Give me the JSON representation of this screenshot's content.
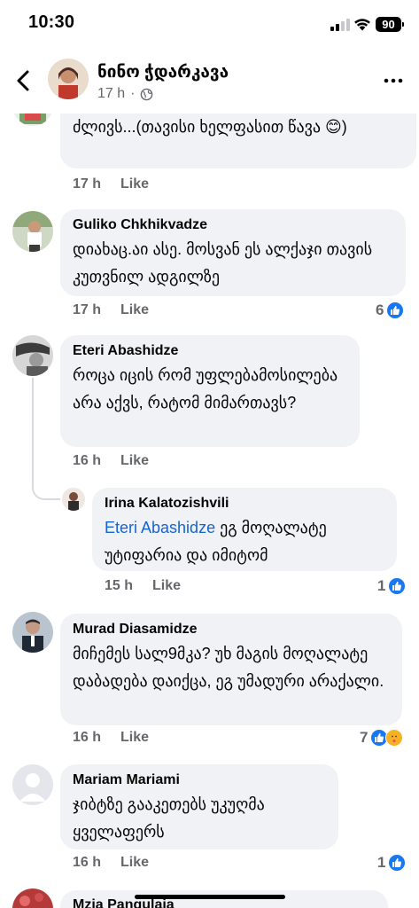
{
  "status_bar": {
    "time": "10:30",
    "battery": "90"
  },
  "header": {
    "name": "ნინო ჭდარკავა",
    "time": "17 h"
  },
  "comments": [
    {
      "author": "",
      "text": "ძლივს...(თავისი ხელფასით წავა 😊)",
      "time": "17 h",
      "like_label": "Like",
      "reaction_count": ""
    },
    {
      "author": "Guliko Chkhikvadze",
      "text": "დიახაც.აი ასე. მოსვან ეს ალქაჯი თავის კუთვნილ ადგილზე",
      "time": "17 h",
      "like_label": "Like",
      "reaction_count": "6"
    },
    {
      "author": "Eteri Abashidze",
      "text": "როცა იცის რომ უფლებამოსილება არა აქვს, რატომ მიმართავს?",
      "time": "16 h",
      "like_label": "Like",
      "reaction_count": ""
    },
    {
      "author": "Irina Kalatozishvili",
      "mention": "Eteri Abashidze",
      "text": " ეგ მოღალატე უტიფარია და  იმიტომ",
      "time": "15 h",
      "like_label": "Like",
      "reaction_count": "1"
    },
    {
      "author": "Murad Diasamidze",
      "text": "მიჩემეს სალ9მკა? უხ მაგის მოღალატე დაბადება დაიქცა, ეგ უმადური არაქალი.",
      "time": "16 h",
      "like_label": "Like",
      "reaction_count": "7"
    },
    {
      "author": "Mariam Mariami",
      "text": "ჯიბტზე გააკეთებს უკუღმა ყველაფერს",
      "time": "16 h",
      "like_label": "Like",
      "reaction_count": "1"
    },
    {
      "author": "Mzia Pangulaia",
      "text": ""
    }
  ],
  "colors": {
    "like_blue": "#1877f2",
    "bubble": "#f0f2f5",
    "mention": "#1763cf",
    "meta_gray": "#65676b"
  },
  "icons": [
    "back-arrow-icon",
    "globe-icon",
    "more-icon",
    "like-reaction-icon",
    "care-reaction-icon",
    "signal-icon",
    "wifi-icon",
    "battery-icon"
  ]
}
